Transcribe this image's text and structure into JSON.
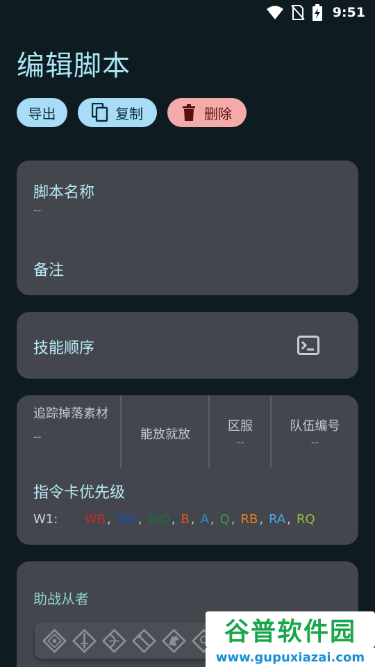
{
  "status_bar": {
    "time": "9:51"
  },
  "page": {
    "title": "编辑脚本"
  },
  "actions": {
    "export_label": "导出",
    "copy_label": "复制",
    "delete_label": "删除"
  },
  "script_info": {
    "name_label": "脚本名称",
    "name_value": "--",
    "note_label": "备注"
  },
  "skill_order": {
    "label": "技能顺序"
  },
  "settings": {
    "track_drops_label": "追踪掉落素材",
    "track_drops_value": "--",
    "auto_cast_label": "能放就放",
    "server_label": "区服",
    "server_value": "--",
    "team_label": "队伍编号",
    "team_value": "--"
  },
  "card_priority": {
    "label": "指令卡优先级",
    "wave_label": "W1:",
    "items": [
      {
        "text": "WB",
        "color": "#c62828"
      },
      {
        "text": "WA",
        "color": "#1e4fa8"
      },
      {
        "text": "WQ",
        "color": "#1b6e3a"
      },
      {
        "text": "B",
        "color": "#e0542f"
      },
      {
        "text": "A",
        "color": "#2f8fd8"
      },
      {
        "text": "Q",
        "color": "#3d9a4a"
      },
      {
        "text": "RB",
        "color": "#e8811f"
      },
      {
        "text": "RA",
        "color": "#4aa6e8"
      },
      {
        "text": "RQ",
        "color": "#8fbf3a"
      }
    ]
  },
  "support": {
    "label": "助战从者"
  },
  "watermark": {
    "title": "谷普软件园",
    "url": "www.gupuxiazai.com"
  },
  "colors": {
    "background": "#0e1c22",
    "card": "#43474d",
    "accent": "#a9e6f2",
    "button_blue": "#a8dcf7",
    "button_red": "#f3aaa8"
  }
}
